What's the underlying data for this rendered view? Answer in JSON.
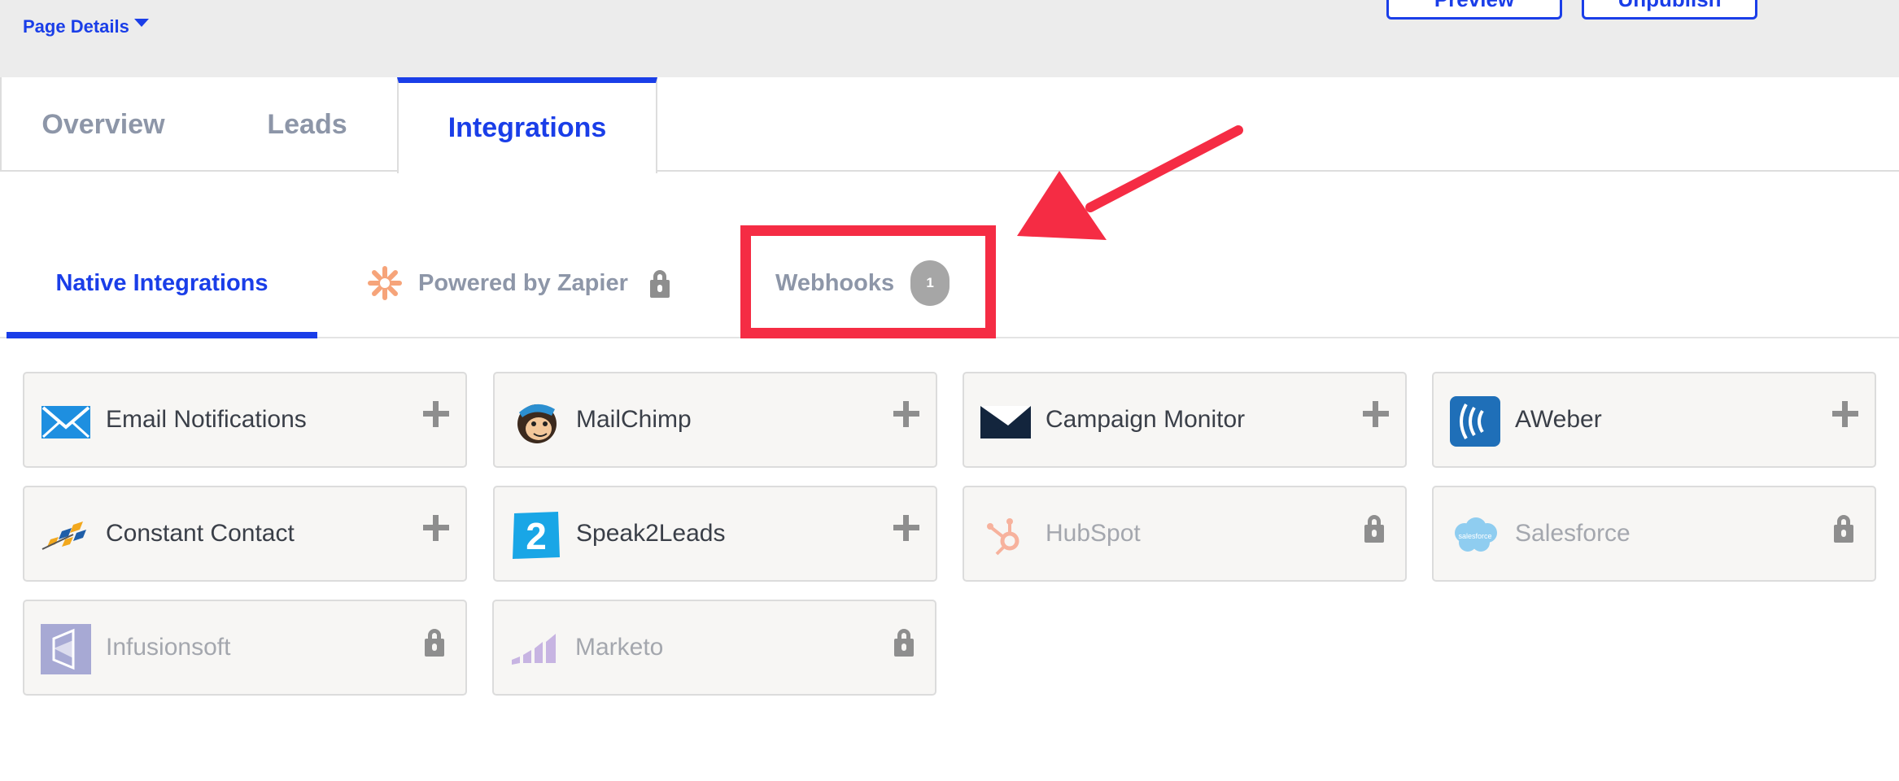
{
  "header": {
    "page_details_label": "Page Details",
    "preview_label": "Preview",
    "unpublish_label": "Unpublish"
  },
  "main_tabs": [
    {
      "label": "Overview",
      "active": false
    },
    {
      "label": "Leads",
      "active": false
    },
    {
      "label": "Integrations",
      "active": true
    }
  ],
  "sub_tabs": {
    "native": {
      "label": "Native Integrations",
      "active": true
    },
    "zapier": {
      "label": "Powered by Zapier",
      "locked": true
    },
    "webhooks": {
      "label": "Webhooks",
      "count": "1"
    }
  },
  "integrations": [
    {
      "name": "Email Notifications",
      "icon": "envelope-icon",
      "status": "add"
    },
    {
      "name": "MailChimp",
      "icon": "mailchimp-icon",
      "status": "add"
    },
    {
      "name": "Campaign Monitor",
      "icon": "campaign-monitor-icon",
      "status": "add"
    },
    {
      "name": "AWeber",
      "icon": "aweber-icon",
      "status": "add"
    },
    {
      "name": "Constant Contact",
      "icon": "constant-contact-icon",
      "status": "add"
    },
    {
      "name": "Speak2Leads",
      "icon": "speak2leads-icon",
      "status": "add"
    },
    {
      "name": "HubSpot",
      "icon": "hubspot-icon",
      "status": "locked"
    },
    {
      "name": "Salesforce",
      "icon": "salesforce-icon",
      "status": "locked"
    },
    {
      "name": "Infusionsoft",
      "icon": "infusionsoft-icon",
      "status": "locked"
    },
    {
      "name": "Marketo",
      "icon": "marketo-icon",
      "status": "locked"
    }
  ],
  "salesforce_logo_text": "salesforce",
  "speak2leads_logo_text": "2",
  "colors": {
    "accent": "#1a3ee8",
    "highlight": "#f52c44",
    "muted_text": "#8d96a8",
    "card_bg": "#f7f6f4"
  }
}
